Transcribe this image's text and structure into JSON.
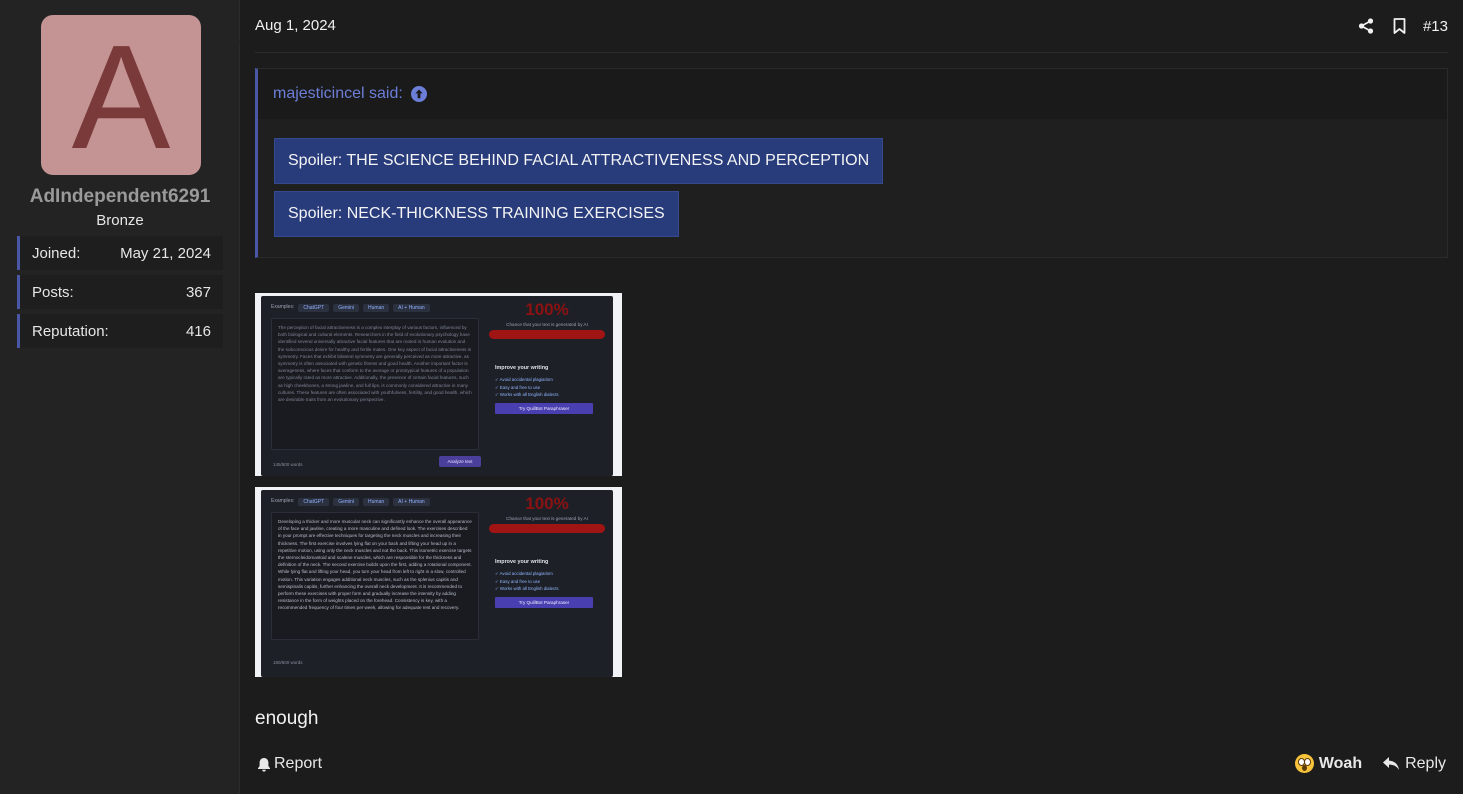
{
  "user": {
    "avatar_letter": "A",
    "username": "AdIndependent6291",
    "rank": "Bronze",
    "stats": [
      {
        "label": "Joined:",
        "value": "May 21, 2024"
      },
      {
        "label": "Posts:",
        "value": "367"
      },
      {
        "label": "Reputation:",
        "value": "416"
      }
    ]
  },
  "post": {
    "date": "Aug 1, 2024",
    "number": "#13",
    "quote": {
      "author_line": "majesticincel said:",
      "spoilers": [
        "Spoiler: THE SCIENCE BEHIND FACIAL ATTRACTIVENESS AND PERCEPTION",
        "Spoiler: NECK-THICKNESS TRAINING EXERCISES"
      ]
    },
    "attachments": [
      {
        "examples_label": "Examples:",
        "examples": [
          "ChatGPT",
          "Gemini",
          "Human",
          "AI + Human"
        ],
        "text": "The perception of facial attractiveness is a complex interplay of various factors, influenced by both biological and cultural elements. Researchers in the field of evolutionary psychology have identified several universally attractive facial features that are rooted in human evolution and the subconscious desire for healthy and fertile mates. One key aspect of facial attractiveness is symmetry. Faces that exhibit bilateral symmetry are generally perceived as more attractive, as symmetry is often associated with genetic fitness and good health. Another important factor is averageness, where faces that conform to the average or prototypical features of a population are typically rated as more attractive. Additionally, the presence of certain facial features, such as high cheekbones, a strong jawline, and full lips, is commonly considered attractive in many cultures. These features are often associated with youthfulness, fertility, and good health, which are desirable traits from an evolutionary perspective.",
        "word_count": "145/500 words",
        "analyze_label": "Analyze text",
        "percent": "100%",
        "percent_caption": "Chance that your text is generated by AI",
        "improve_title": "Improve your writing",
        "improve_items": [
          "✓ Avoid accidental plagiarism",
          "✓ Easy and free to use",
          "✓ Works with all English dialects"
        ],
        "cta_label": "Try QuillBot Paraphraser"
      },
      {
        "examples_label": "Examples:",
        "examples": [
          "ChatGPT",
          "Gemini",
          "Human",
          "AI + Human"
        ],
        "text": "Developing a thicker and more muscular neck can significantly enhance the overall appearance of the face and jawline, creating a more masculine and defined look. The exercises described in your prompt are effective techniques for targeting the neck muscles and increasing their thickness. The first exercise involves lying flat on your back and lifting your head up in a repetitive motion, using only the neck muscles and not the back. This isometric exercise targets the sternocleidomastoid and scalene muscles, which are responsible for the thickness and definition of the neck. The second exercise builds upon the first, adding a rotational component. While lying flat and lifting your head, you turn your head from left to right in a slow, controlled motion. This variation engages additional neck muscles, such as the splenius capitis and semispinalis capitis, further enhancing the overall neck development. It is recommended to perform these exercises with proper form and gradually increase the intensity by adding resistance in the form of weights placed on the forehead. Consistency is key, with a recommended frequency of four times per week, allowing for adequate rest and recovery.",
        "word_count": "180/500 words",
        "analyze_label": "",
        "percent": "100%",
        "percent_caption": "Chance that your text is generated by AI",
        "improve_title": "Improve your writing",
        "improve_items": [
          "✓ Avoid accidental plagiarism",
          "✓ Easy and free to use",
          "✓ Works with all English dialects"
        ],
        "cta_label": "Try QuillBot Paraphraser"
      }
    ],
    "message": "enough",
    "footer": {
      "report_label": "Report",
      "reaction_label": "Woah",
      "reply_label": "Reply"
    }
  },
  "colors": {
    "accent": "#4a56a6",
    "link": "#6c7ed8",
    "spoiler_bg": "#283b7b",
    "avatar_bg": "#c49393"
  }
}
